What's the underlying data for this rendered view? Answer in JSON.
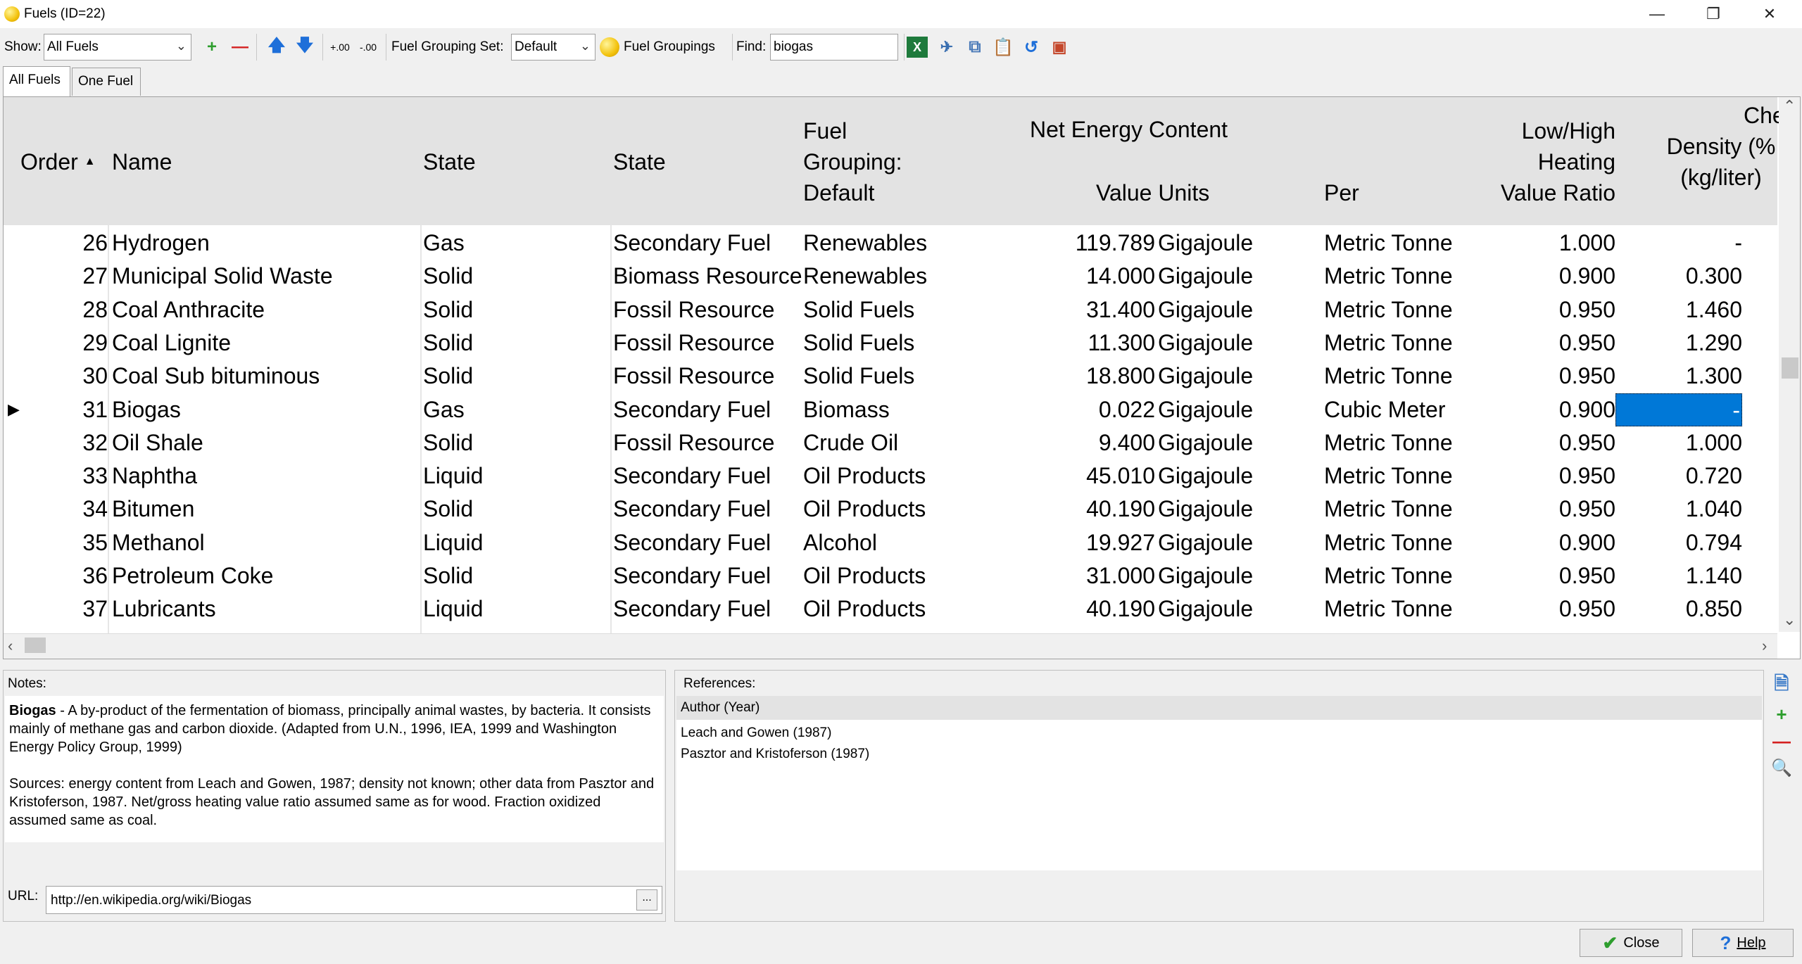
{
  "window": {
    "title": "Fuels (ID=22)"
  },
  "toolbar": {
    "show_label": "Show:",
    "show_value": "All Fuels",
    "fuel_grouping_set_label": "Fuel Grouping Set:",
    "fuel_grouping_set_value": "Default",
    "fuel_groupings_label": "Fuel Groupings",
    "find_label": "Find:",
    "find_value": "biogas"
  },
  "tabs": [
    {
      "label": "All Fuels",
      "active": true
    },
    {
      "label": "One Fuel",
      "active": false
    }
  ],
  "grid": {
    "headers": {
      "order": "Order",
      "name": "Name",
      "state1": "State",
      "state2": "State",
      "fuel_grouping": [
        "Fuel",
        "Grouping:",
        "Default"
      ],
      "net_energy": "Net Energy Content",
      "value_units": "Value Units",
      "per": "Per",
      "lhv_ratio": [
        "Low/High",
        "Heating",
        "Value Ratio"
      ],
      "density": [
        "Density (%",
        "(kg/liter)"
      ],
      "chem_partial": "Che"
    },
    "rows": [
      {
        "order": "26",
        "name": "Hydrogen",
        "state": "Gas",
        "resource": "Secondary Fuel",
        "group": "Renewables",
        "value": "119.789",
        "units": "Gigajoule",
        "per": "Metric Tonne",
        "ratio": "1.000",
        "density": "-"
      },
      {
        "order": "27",
        "name": "Municipal Solid Waste",
        "state": "Solid",
        "resource": "Biomass Resource",
        "group": "Renewables",
        "value": "14.000",
        "units": "Gigajoule",
        "per": "Metric Tonne",
        "ratio": "0.900",
        "density": "0.300"
      },
      {
        "order": "28",
        "name": "Coal Anthracite",
        "state": "Solid",
        "resource": "Fossil Resource",
        "group": "Solid Fuels",
        "value": "31.400",
        "units": "Gigajoule",
        "per": "Metric Tonne",
        "ratio": "0.950",
        "density": "1.460"
      },
      {
        "order": "29",
        "name": "Coal Lignite",
        "state": "Solid",
        "resource": "Fossil Resource",
        "group": "Solid Fuels",
        "value": "11.300",
        "units": "Gigajoule",
        "per": "Metric Tonne",
        "ratio": "0.950",
        "density": "1.290"
      },
      {
        "order": "30",
        "name": "Coal Sub bituminous",
        "state": "Solid",
        "resource": "Fossil Resource",
        "group": "Solid Fuels",
        "value": "18.800",
        "units": "Gigajoule",
        "per": "Metric Tonne",
        "ratio": "0.950",
        "density": "1.300"
      },
      {
        "order": "31",
        "name": "Biogas",
        "state": "Gas",
        "resource": "Secondary Fuel",
        "group": "Biomass",
        "value": "0.022",
        "units": "Gigajoule",
        "per": "Cubic Meter",
        "ratio": "0.900",
        "density": "-"
      },
      {
        "order": "32",
        "name": "Oil Shale",
        "state": "Solid",
        "resource": "Fossil Resource",
        "group": "Crude Oil",
        "value": "9.400",
        "units": "Gigajoule",
        "per": "Metric Tonne",
        "ratio": "0.950",
        "density": "1.000"
      },
      {
        "order": "33",
        "name": "Naphtha",
        "state": "Liquid",
        "resource": "Secondary Fuel",
        "group": "Oil Products",
        "value": "45.010",
        "units": "Gigajoule",
        "per": "Metric Tonne",
        "ratio": "0.950",
        "density": "0.720"
      },
      {
        "order": "34",
        "name": "Bitumen",
        "state": "Solid",
        "resource": "Secondary Fuel",
        "group": "Oil Products",
        "value": "40.190",
        "units": "Gigajoule",
        "per": "Metric Tonne",
        "ratio": "0.950",
        "density": "1.040"
      },
      {
        "order": "35",
        "name": "Methanol",
        "state": "Liquid",
        "resource": "Secondary Fuel",
        "group": "Alcohol",
        "value": "19.927",
        "units": "Gigajoule",
        "per": "Metric Tonne",
        "ratio": "0.900",
        "density": "0.794"
      },
      {
        "order": "36",
        "name": "Petroleum Coke",
        "state": "Solid",
        "resource": "Secondary Fuel",
        "group": "Oil Products",
        "value": "31.000",
        "units": "Gigajoule",
        "per": "Metric Tonne",
        "ratio": "0.950",
        "density": "1.140"
      },
      {
        "order": "37",
        "name": "Lubricants",
        "state": "Liquid",
        "resource": "Secondary Fuel",
        "group": "Oil Products",
        "value": "40.190",
        "units": "Gigajoule",
        "per": "Metric Tonne",
        "ratio": "0.950",
        "density": "0.850"
      }
    ]
  },
  "notes": {
    "label": "Notes:",
    "bold_term": "Biogas",
    "para1": " - A by-product of the fermentation of biomass, principally animal wastes, by bacteria. It consists mainly of methane gas and carbon dioxide. (Adapted from U.N., 1996, IEA, 1999 and Washington Energy Policy Group, 1999)",
    "para2": "Sources: energy content from Leach and Gowen, 1987; density not known; other data from Pasztor and Kristoferson, 1987.  Net/gross heating value ratio assumed same as for wood. Fraction oxidized  assumed same as coal.",
    "url_label": "URL:",
    "url_value": "http://en.wikipedia.org/wiki/Biogas",
    "url_button": "..."
  },
  "references": {
    "label": "References:",
    "column": "Author (Year)",
    "items": [
      "Leach and Gowen (1987)",
      "Pasztor and Kristoferson (1987)"
    ]
  },
  "buttons": {
    "close": "Close",
    "help": "Help"
  },
  "colors": {
    "selection": "#0078d7",
    "add_green": "#2e9e2e",
    "remove_red": "#d42020",
    "arrow_blue": "#1e6fd9"
  }
}
